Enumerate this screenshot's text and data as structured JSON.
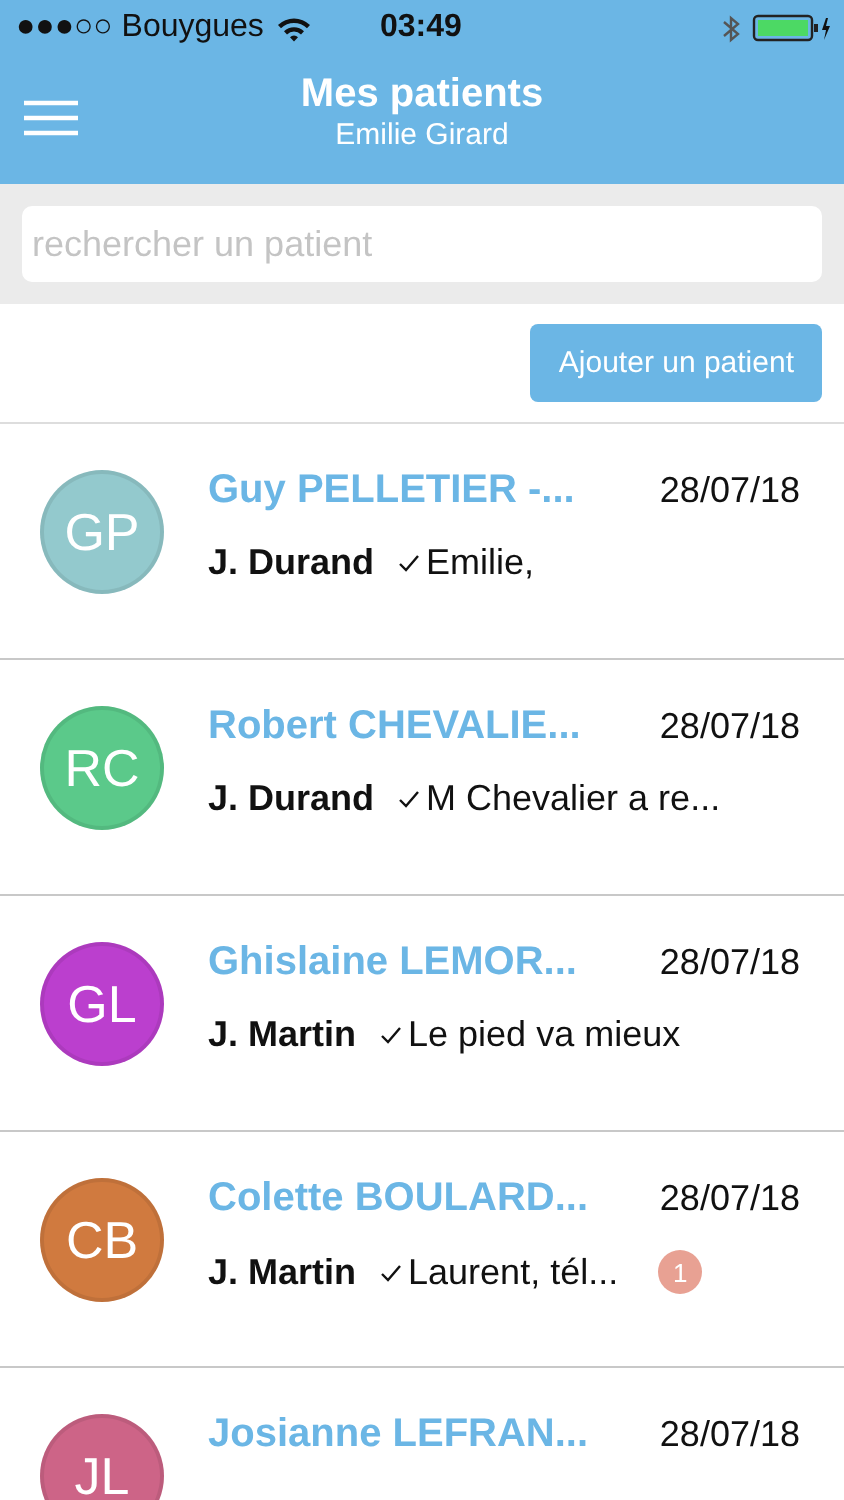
{
  "status_bar": {
    "carrier": "●●●○○ Bouygues",
    "time": "03:49"
  },
  "header": {
    "title": "Mes patients",
    "subtitle": "Emilie Girard"
  },
  "search": {
    "placeholder": "rechercher un patient"
  },
  "add_button": {
    "label": "Ajouter un patient"
  },
  "patients": [
    {
      "initials": "GP",
      "color": "#93c9cd",
      "name": "Guy PELLETIER -...",
      "date": "28/07/18",
      "doctor": "J. Durand",
      "message": "Emilie,"
    },
    {
      "initials": "RC",
      "color": "#5bc98a",
      "name": "Robert CHEVALIE...",
      "date": "28/07/18",
      "doctor": "J. Durand",
      "message": "M Chevalier a re..."
    },
    {
      "initials": "GL",
      "color": "#bb3fce",
      "name": "Ghislaine LEMOR...",
      "date": "28/07/18",
      "doctor": "J. Martin",
      "message": "Le pied va mieux"
    },
    {
      "initials": "CB",
      "color": "#d07a3f",
      "name": "Colette BOULARD...",
      "date": "28/07/18",
      "doctor": "J. Martin",
      "message": "Laurent, tél...",
      "badge": "1"
    },
    {
      "initials": "JL",
      "color": "#cd6487",
      "name": "Josianne LEFRAN...",
      "date": "28/07/18"
    }
  ]
}
